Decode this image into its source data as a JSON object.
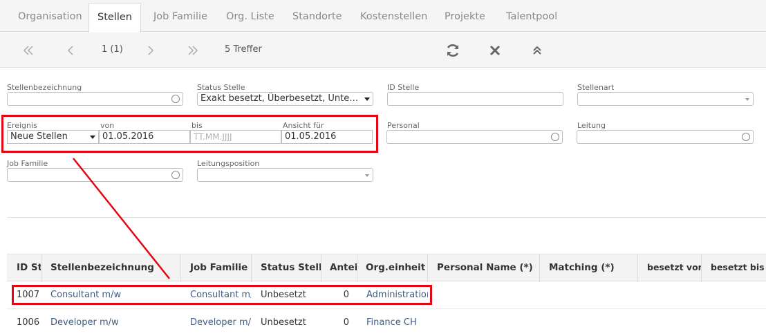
{
  "tabs": [
    {
      "label": "Organisation"
    },
    {
      "label": "Stellen"
    },
    {
      "label": "Job Familie"
    },
    {
      "label": "Org. Liste"
    },
    {
      "label": "Standorte"
    },
    {
      "label": "Kostenstellen"
    },
    {
      "label": "Projekte"
    },
    {
      "label": "Talentpool"
    }
  ],
  "toolbar": {
    "page_indicator": "1 (1)",
    "hits": "5 Treffer",
    "icons": [
      "first-page-icon",
      "prev-page-icon",
      "next-page-icon",
      "last-page-icon",
      "refresh-icon",
      "clear-icon",
      "collapse-icon"
    ]
  },
  "filters": {
    "stellenbezeichnung": {
      "label": "Stellenbezeichnung",
      "value": ""
    },
    "status_stelle": {
      "label": "Status Stelle",
      "value": "Exakt besetzt, Überbesetzt, Unterbes…"
    },
    "id_stelle": {
      "label": "ID Stelle",
      "value": ""
    },
    "stellenart": {
      "label": "Stellenart",
      "value": ""
    },
    "ereignis": {
      "label": "Ereignis",
      "value": "Neue Stellen"
    },
    "von": {
      "label": "von",
      "value": "01.05.2016"
    },
    "bis": {
      "label": "bis",
      "placeholder": "TT.MM.JJJJ"
    },
    "ansicht_fuer": {
      "label": "Ansicht für",
      "value": "01.05.2016"
    },
    "personal": {
      "label": "Personal",
      "value": ""
    },
    "leitung": {
      "label": "Leitung",
      "value": ""
    },
    "job_familie": {
      "label": "Job Familie",
      "value": ""
    },
    "leitungsposition": {
      "label": "Leitungsposition",
      "value": ""
    }
  },
  "table": {
    "columns": [
      "ID Ste",
      "Stellenbezeichnung",
      "Job Familie",
      "Status Stelle",
      "Anteil",
      "Org.einheit (*)",
      "Personal Name (*)",
      "Matching (*)",
      "besetzt von (",
      "besetzt bis (*"
    ],
    "rows": [
      {
        "id": "1007",
        "stellenbezeichnung": "Consultant m/w",
        "job_familie": "Consultant m/w",
        "status": "Unbesetzt",
        "anteil": "0",
        "org_einheit": "Administration"
      },
      {
        "id": "1006",
        "stellenbezeichnung": "Developer m/w",
        "job_familie": "Developer m/w",
        "status": "Unbesetzt",
        "anteil": "0",
        "org_einheit": "Finance CH"
      }
    ]
  },
  "colors": {
    "highlight": "#e30613",
    "link": "#3e5d86"
  }
}
